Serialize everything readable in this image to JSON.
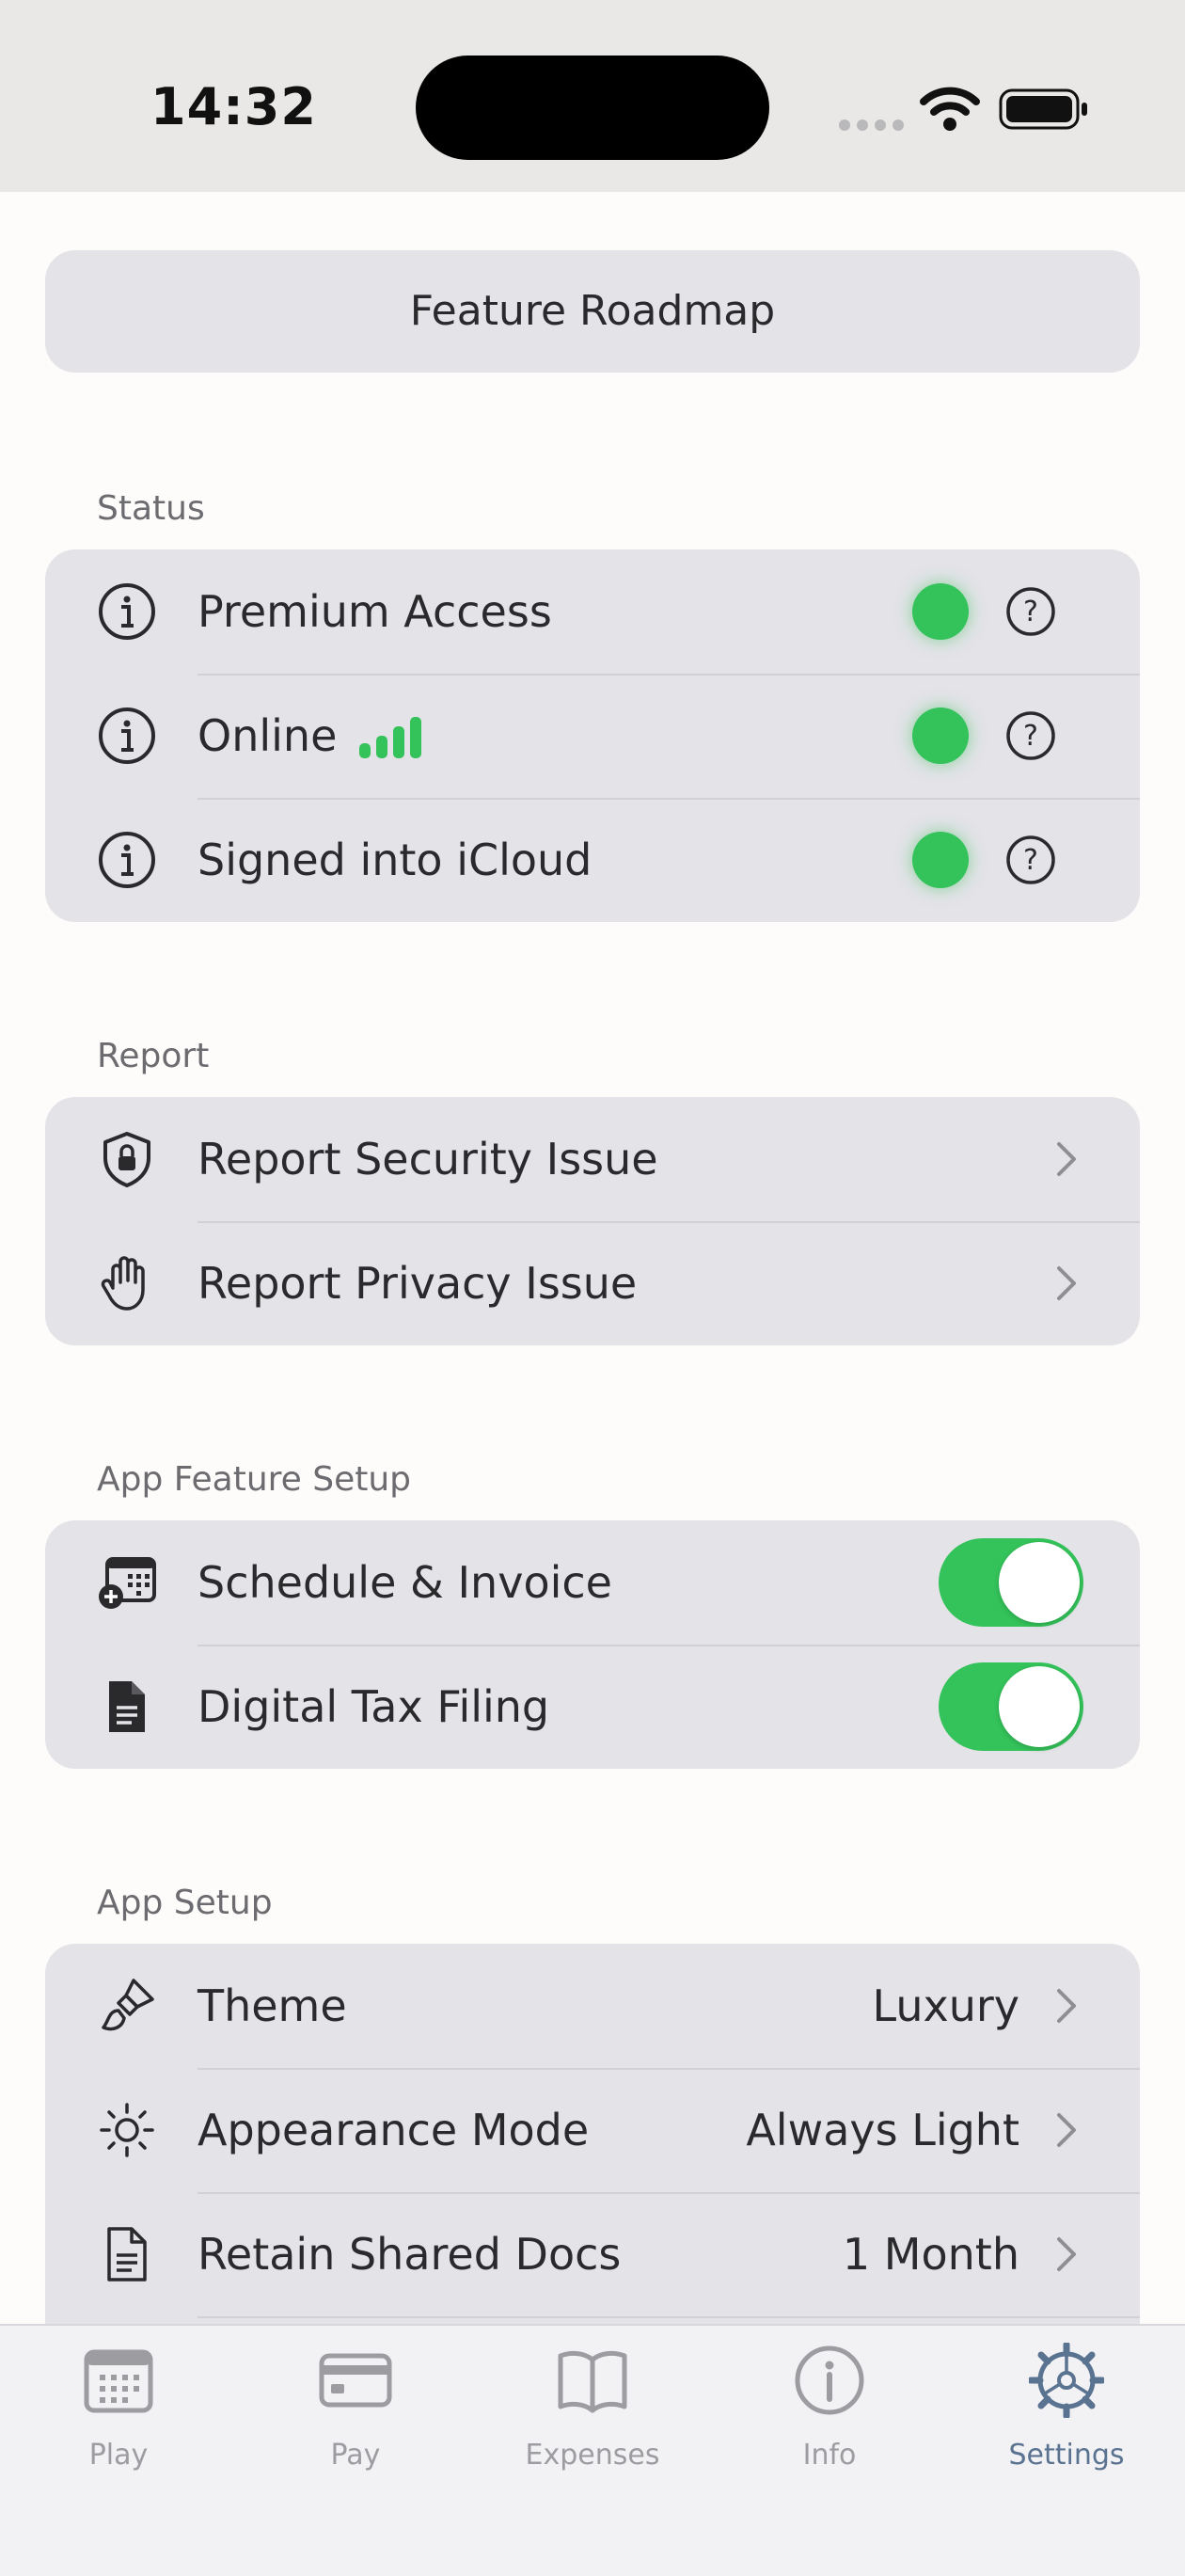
{
  "status_bar": {
    "time": "14:32"
  },
  "roadmap_button": {
    "label": "Feature Roadmap"
  },
  "status_section": {
    "title": "Status",
    "rows": [
      {
        "label": "Premium Access",
        "icon": "info-icon",
        "status": "green"
      },
      {
        "label": "Online",
        "icon": "info-icon",
        "status": "green",
        "signal_icon": "signal-bars-icon"
      },
      {
        "label": "Signed into iCloud",
        "icon": "info-icon",
        "status": "green"
      }
    ]
  },
  "report_section": {
    "title": "Report",
    "rows": [
      {
        "label": "Report Security Issue",
        "icon": "shield-lock-icon"
      },
      {
        "label": "Report Privacy Issue",
        "icon": "hand-icon"
      }
    ]
  },
  "feature_section": {
    "title": "App Feature Setup",
    "rows": [
      {
        "label": "Schedule & Invoice",
        "icon": "calendar-add-icon",
        "enabled": true
      },
      {
        "label": "Digital Tax Filing",
        "icon": "document-icon",
        "enabled": true
      }
    ]
  },
  "app_setup_section": {
    "title": "App Setup",
    "rows": [
      {
        "label": "Theme",
        "value": "Luxury",
        "icon": "paintbrush-icon"
      },
      {
        "label": "Appearance Mode",
        "value": "Always Light",
        "icon": "sun-icon"
      },
      {
        "label": "Retain Shared Docs",
        "value": "1 Month",
        "icon": "document-outline-icon"
      }
    ]
  },
  "tab_bar": {
    "tabs": [
      {
        "label": "Play",
        "icon": "calendar-icon",
        "active": false
      },
      {
        "label": "Pay",
        "icon": "credit-card-icon",
        "active": false
      },
      {
        "label": "Expenses",
        "icon": "book-icon",
        "active": false
      },
      {
        "label": "Info",
        "icon": "info-circle-icon",
        "active": false
      },
      {
        "label": "Settings",
        "icon": "gear-icon",
        "active": true
      }
    ]
  },
  "colors": {
    "accent_green": "#34C35A",
    "active_tab": "#5A7391",
    "inactive_tab": "#9C9CA1",
    "group_background": "#E4E3E8"
  }
}
